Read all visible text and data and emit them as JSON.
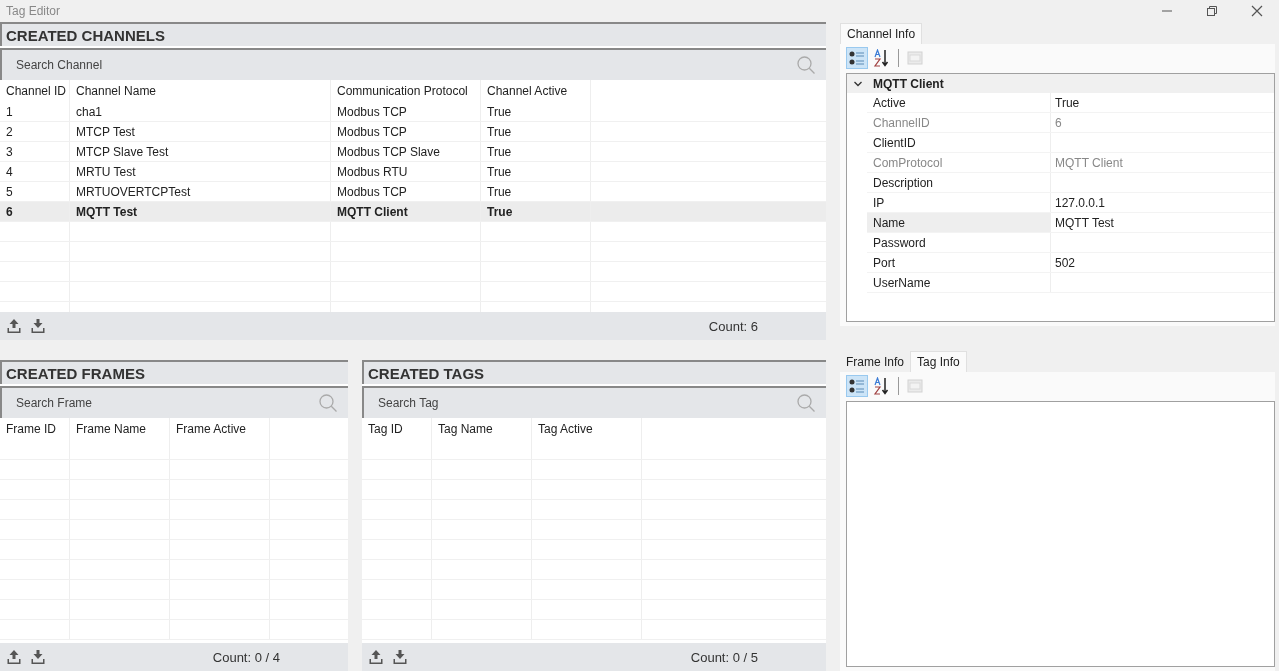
{
  "window": {
    "title": "Tag Editor"
  },
  "channels": {
    "title": "CREATED CHANNELS",
    "search": {
      "placeholder": "Search Channel"
    },
    "columns": [
      "Channel ID",
      "Channel Name",
      "Communication Protocol",
      "Channel Active"
    ],
    "rows": [
      {
        "cells": [
          "1",
          "cha1",
          "Modbus TCP",
          "True"
        ],
        "selected": false
      },
      {
        "cells": [
          "2",
          "MTCP Test",
          "Modbus TCP",
          "True"
        ],
        "selected": false
      },
      {
        "cells": [
          "3",
          "MTCP Slave Test",
          "Modbus TCP Slave",
          "True"
        ],
        "selected": false
      },
      {
        "cells": [
          "4",
          "MRTU Test",
          "Modbus RTU",
          "True"
        ],
        "selected": false
      },
      {
        "cells": [
          "5",
          "MRTUOVERTCPTest",
          "Modbus TCP",
          "True"
        ],
        "selected": false
      },
      {
        "cells": [
          "6",
          "MQTT Test",
          "MQTT Client",
          "True"
        ],
        "selected": true
      }
    ],
    "count": "Count: 6"
  },
  "frames": {
    "title": "CREATED FRAMES",
    "search": {
      "placeholder": "Search Frame"
    },
    "columns": [
      "Frame ID",
      "Frame Name",
      "Frame Active"
    ],
    "count": "Count: 0 / 4"
  },
  "tags": {
    "title": "CREATED TAGS",
    "search": {
      "placeholder": "Search Tag"
    },
    "columns": [
      "Tag ID",
      "Tag Name",
      "Tag Active"
    ],
    "count": "Count: 0 / 5"
  },
  "channel_info": {
    "tabs": [
      {
        "label": "Channel Info",
        "selected": true
      }
    ],
    "toolbar": [
      {
        "kind": "categorized",
        "selected": true,
        "disabled": false
      },
      {
        "kind": "alphabetical",
        "selected": false,
        "disabled": false
      },
      {
        "kind": "pages",
        "selected": false,
        "disabled": true
      }
    ],
    "grid": {
      "category": "MQTT Client",
      "expanded": true,
      "properties": [
        {
          "name": "Active",
          "value": "True",
          "readonly": false,
          "selected": false
        },
        {
          "name": "ChannelID",
          "value": "6",
          "readonly": true,
          "selected": false
        },
        {
          "name": "ClientID",
          "readonly": false,
          "selected": false
        },
        {
          "name": "ComProtocol",
          "value": "MQTT Client",
          "readonly": true,
          "selected": false
        },
        {
          "name": "Description",
          "readonly": false,
          "selected": false
        },
        {
          "name": "IP",
          "value": "127.0.0.1",
          "readonly": false,
          "selected": false
        },
        {
          "name": "Name",
          "value": "MQTT Test",
          "readonly": false,
          "selected": true
        },
        {
          "name": "Password",
          "readonly": false,
          "selected": false
        },
        {
          "name": "Port",
          "value": "502",
          "readonly": false,
          "selected": false
        },
        {
          "name": "UserName",
          "readonly": false,
          "selected": false
        }
      ]
    }
  },
  "object_info": {
    "tabs": [
      {
        "label": "Frame Info",
        "selected": false
      },
      {
        "label": "Tag Info",
        "selected": true
      }
    ],
    "toolbar": [
      {
        "kind": "categorized",
        "selected": true,
        "disabled": false
      },
      {
        "kind": "alphabetical",
        "selected": false,
        "disabled": false
      },
      {
        "kind": "pages",
        "selected": false,
        "disabled": true
      }
    ]
  }
}
